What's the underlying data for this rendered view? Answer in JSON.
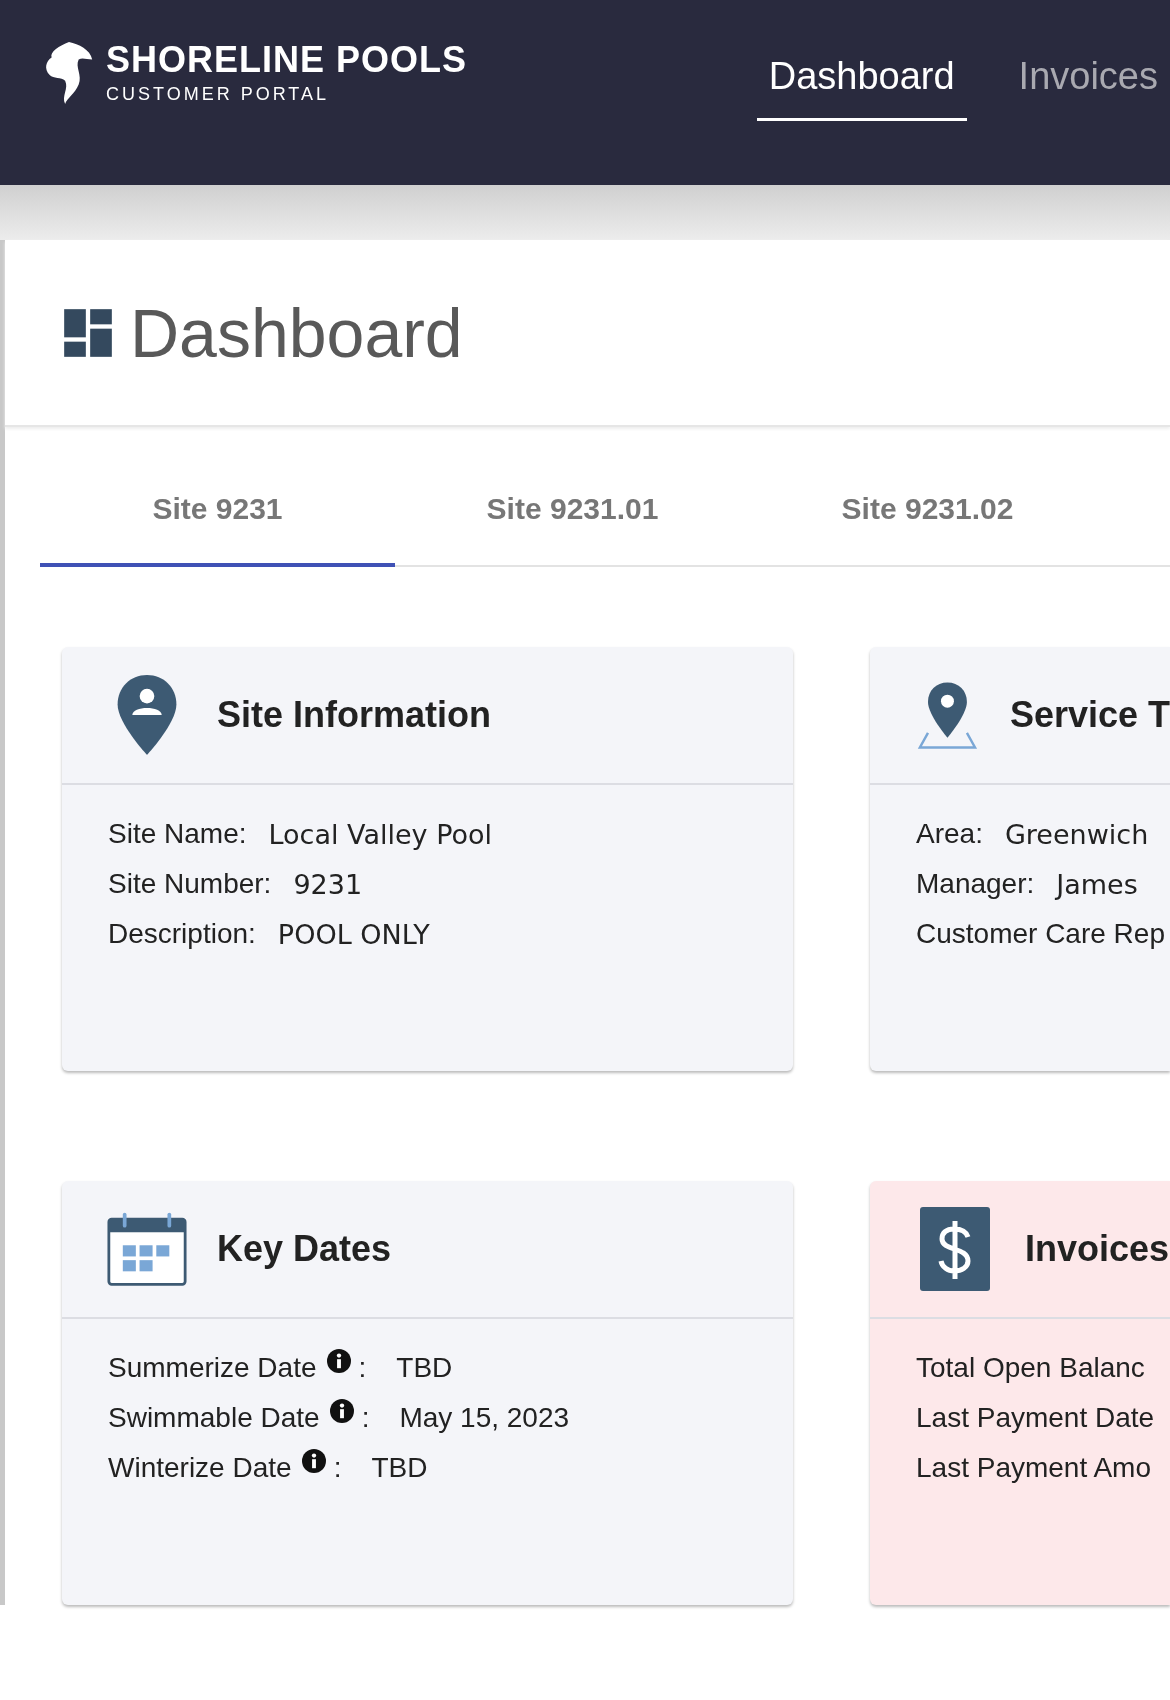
{
  "header": {
    "brand": {
      "name": "SHORELINE POOLS",
      "subtitle": "CUSTOMER PORTAL"
    },
    "nav": [
      {
        "label": "Dashboard",
        "selected": true
      },
      {
        "label": "Invoices",
        "selected": false
      }
    ]
  },
  "page": {
    "title": "Dashboard"
  },
  "site_tabs": [
    {
      "label": "Site 9231",
      "selected": true
    },
    {
      "label": "Site 9231.01",
      "selected": false
    },
    {
      "label": "Site 9231.02",
      "selected": false
    }
  ],
  "cards": [
    {
      "kind": "site",
      "title": "Site Information",
      "fields": [
        {
          "label": "Site Name:",
          "value": "Local Valley Pool"
        },
        {
          "label": "Site Number:",
          "value": "9231"
        },
        {
          "label": "Description:",
          "value": "POOL ONLY"
        }
      ]
    },
    {
      "kind": "service",
      "title": "Service T",
      "fields": [
        {
          "label": "Area:",
          "value": "Greenwich"
        },
        {
          "label": "Manager:",
          "value": "James"
        },
        {
          "label": "Customer Care Rep"
        }
      ]
    },
    {
      "kind": "dates",
      "title": "Key Dates",
      "fields": [
        {
          "label": "Summerize Date",
          "info": true,
          "separator": ":",
          "value": "TBD"
        },
        {
          "label": "Swimmable Date",
          "info": true,
          "separator": ":",
          "value": "May 15, 2023"
        },
        {
          "label": "Winterize Date",
          "info": true,
          "separator": ":",
          "value": "TBD"
        }
      ]
    },
    {
      "kind": "invoices",
      "title": "Invoices",
      "fields": [
        {
          "label": "Total Open Balanc"
        },
        {
          "label": "Last Payment Date"
        },
        {
          "label": "Last Payment Amo"
        }
      ]
    }
  ]
}
